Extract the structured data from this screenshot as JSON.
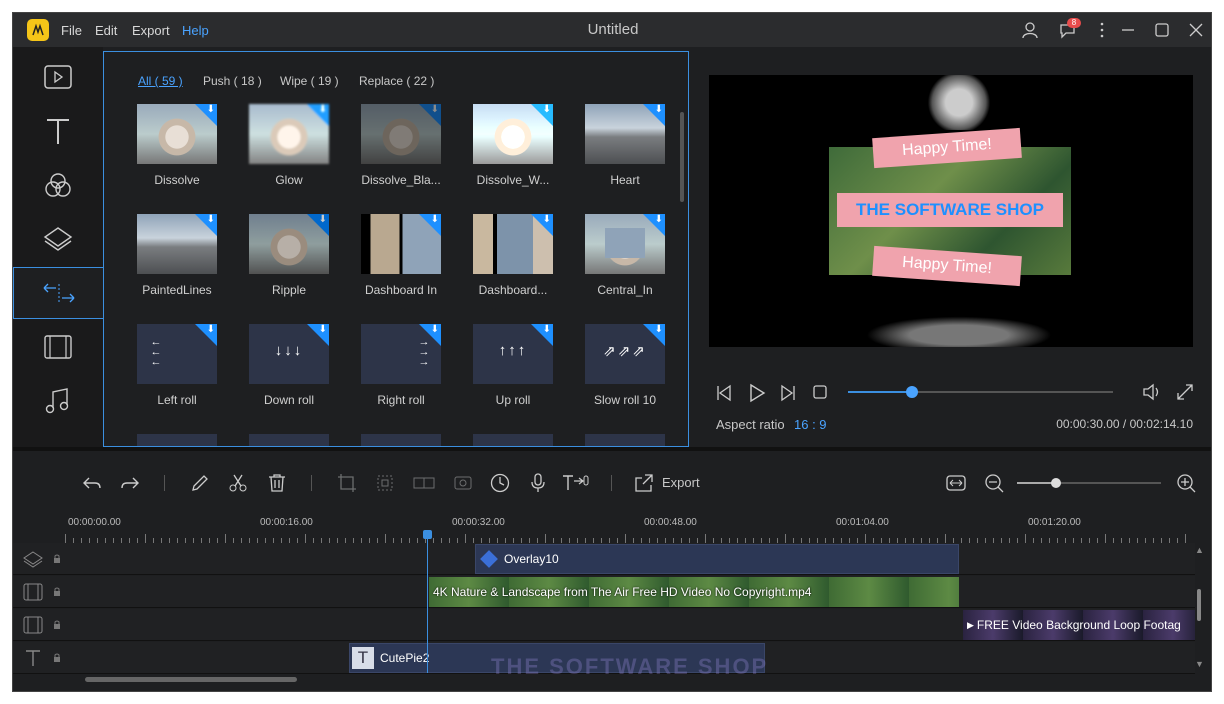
{
  "title_bar": {
    "title": "Untitled",
    "menu": [
      "File",
      "Edit",
      "Export",
      "Help"
    ],
    "notification_count": "8"
  },
  "tabs": [
    {
      "label": "All ( 59 )"
    },
    {
      "label": "Push ( 18 )"
    },
    {
      "label": "Wipe ( 19 )"
    },
    {
      "label": "Replace ( 22 )"
    }
  ],
  "transitions": [
    {
      "label": "Dissolve",
      "icon": "dog-road-thumb"
    },
    {
      "label": "Glow",
      "icon": "dog-glow-thumb"
    },
    {
      "label": "Dissolve_Bla...",
      "icon": "dog-dark-thumb"
    },
    {
      "label": "Dissolve_W...",
      "icon": "dog-light-thumb"
    },
    {
      "label": "Heart",
      "icon": "heart-thumb"
    },
    {
      "label": "PaintedLines",
      "icon": "road-thumb"
    },
    {
      "label": "Ripple",
      "icon": "dog-ripple-thumb"
    },
    {
      "label": "Dashboard In",
      "icon": "dashboard-in-thumb"
    },
    {
      "label": "Dashboard...",
      "icon": "dashboard-thumb"
    },
    {
      "label": "Central_In",
      "icon": "central-in-thumb"
    },
    {
      "label": "Left roll",
      "glyph": "←\n←\n←"
    },
    {
      "label": "Down roll",
      "glyph": "↓↓↓"
    },
    {
      "label": "Right roll",
      "glyph": "→\n→\n→"
    },
    {
      "label": "Up roll",
      "glyph": "↑↑↑"
    },
    {
      "label": "Slow roll 10",
      "glyph": "⇗⇗⇗"
    }
  ],
  "preview": {
    "ribbon_top": "Happy Time!",
    "ribbon_mid": "THE SOFTWARE SHOP",
    "ribbon_bot": "Happy Time!",
    "aspect_label": "Aspect ratio",
    "aspect_value": "16 : 9",
    "time": "00:00:30.00 / 00:02:14.10",
    "progress": 0.24
  },
  "toolbar": {
    "export_label": "Export"
  },
  "ruler": [
    "00:00:00.00",
    "00:00:16.00",
    "00:00:32.00",
    "00:00:48.00",
    "00:01:04.00",
    "00:01:20.00"
  ],
  "clips": {
    "overlay": "Overlay10",
    "video1": "4K Nature & Landscape from The Air Free HD Video No Copyright.mp4",
    "video2": "FREE Video Background Loop Footag",
    "text": "CutePie2"
  },
  "watermark": "THE SOFTWARE SHOP",
  "colors": {
    "accent": "#3b8fe0",
    "ribbon": "#f0a3ad",
    "bg": "#1e1f21"
  }
}
